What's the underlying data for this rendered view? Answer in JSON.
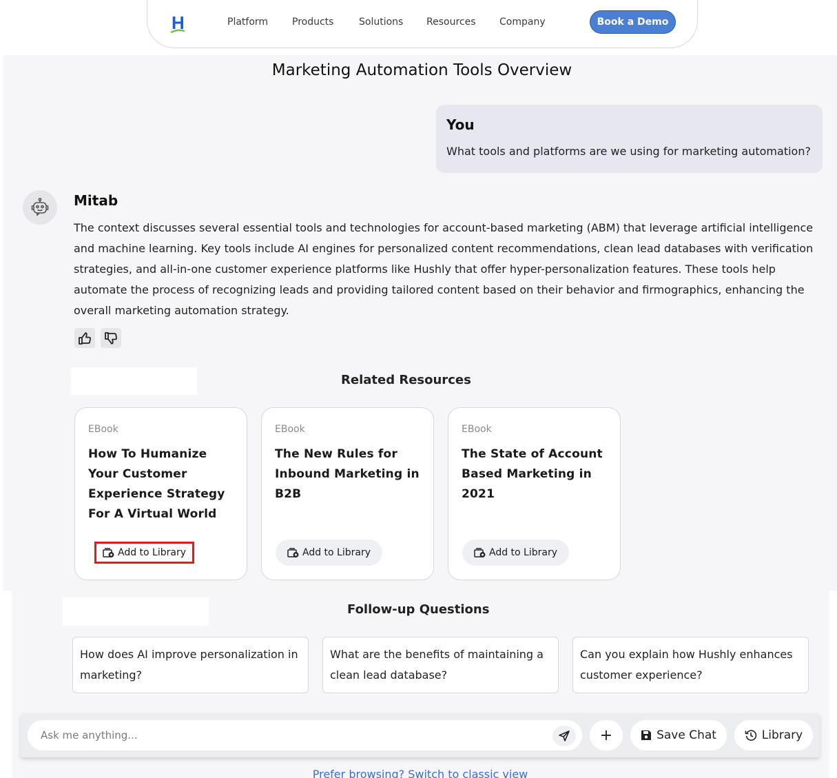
{
  "nav": {
    "logo_letter": "H",
    "items": [
      "Platform",
      "Products",
      "Solutions",
      "Resources",
      "Company"
    ],
    "cta": "Book a Demo"
  },
  "page": {
    "title": "Marketing Automation Tools Overview"
  },
  "user_message": {
    "name": "You",
    "text": "What tools and platforms are we using for marketing automation?"
  },
  "bot_message": {
    "name": "Mitab",
    "text": "The context discusses several essential tools and technologies for account-based marketing (ABM) that leverage artificial intelligence and machine learning. Key tools include AI engines for personalized content recommendations, clean lead databases with verification strategies, and all-in-one customer experience platforms like Hushly that offer hyper-personalization features. These tools help automate the process of recognizing leads and providing tailored content based on their behavior and firmographics, enhancing the overall marketing automation strategy."
  },
  "related": {
    "title": "Related Resources",
    "cards": [
      {
        "type": "EBook",
        "title": "How To Humanize Your Customer Experience Strategy For A Virtual World",
        "button": "Add to Library"
      },
      {
        "type": "EBook",
        "title": "The New Rules for Inbound Marketing in B2B",
        "button": "Add to Library"
      },
      {
        "type": "EBook",
        "title": "The State of Account Based Marketing in 2021",
        "button": "Add to Library"
      }
    ]
  },
  "followup": {
    "title": "Follow-up Questions",
    "questions": [
      "How does AI improve personalization in marketing?",
      "What are the benefits of maintaining a clean lead database?",
      "Can you explain how Hushly enhances customer experience?"
    ]
  },
  "composer": {
    "placeholder": "Ask me anything...",
    "plus": "+",
    "save_label": "Save Chat",
    "library_label": "Library"
  },
  "footer": {
    "classic_link": "Prefer browsing? Switch to classic view"
  },
  "colors": {
    "accent": "#4a7fd4",
    "highlight": "#e01b24",
    "link": "#3a6fd0"
  }
}
